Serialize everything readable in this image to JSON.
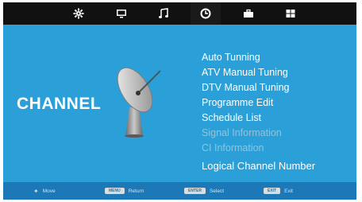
{
  "nav": {
    "tabs": [
      {
        "name": "settings-tab",
        "icon": "gear-icon"
      },
      {
        "name": "picture-tab",
        "icon": "monitor-icon"
      },
      {
        "name": "sound-tab",
        "icon": "music-note-icon"
      },
      {
        "name": "time-tab",
        "icon": "clock-icon"
      },
      {
        "name": "lock-tab",
        "icon": "briefcase-icon"
      },
      {
        "name": "setup-tab",
        "icon": "grid-icon"
      }
    ]
  },
  "category": {
    "title": "CHANNEL",
    "icon": "satellite-dish-icon"
  },
  "menu": {
    "items": [
      {
        "label": "Auto Tunning",
        "state": "enabled"
      },
      {
        "label": "ATV Manual Tuning",
        "state": "enabled"
      },
      {
        "label": "DTV Manual Tuning",
        "state": "enabled"
      },
      {
        "label": "Programme Edit",
        "state": "enabled"
      },
      {
        "label": "Schedule List",
        "state": "enabled"
      },
      {
        "label": "Signal Information",
        "state": "disabled"
      },
      {
        "label": "CI Information",
        "state": "disabled"
      },
      {
        "label": "Logical Channel Number",
        "state": "selected"
      }
    ]
  },
  "hints": {
    "move": {
      "label": "Move"
    },
    "return": {
      "key": "MENU",
      "label": "Return"
    },
    "select": {
      "key": "ENTER",
      "label": "Select"
    },
    "exit": {
      "key": "EXIT",
      "label": "Exit"
    }
  },
  "colors": {
    "background": "#2ba0d8",
    "topbar": "#111111",
    "bottombar": "#1c78b7",
    "disabled_text": "#8fc3de"
  }
}
